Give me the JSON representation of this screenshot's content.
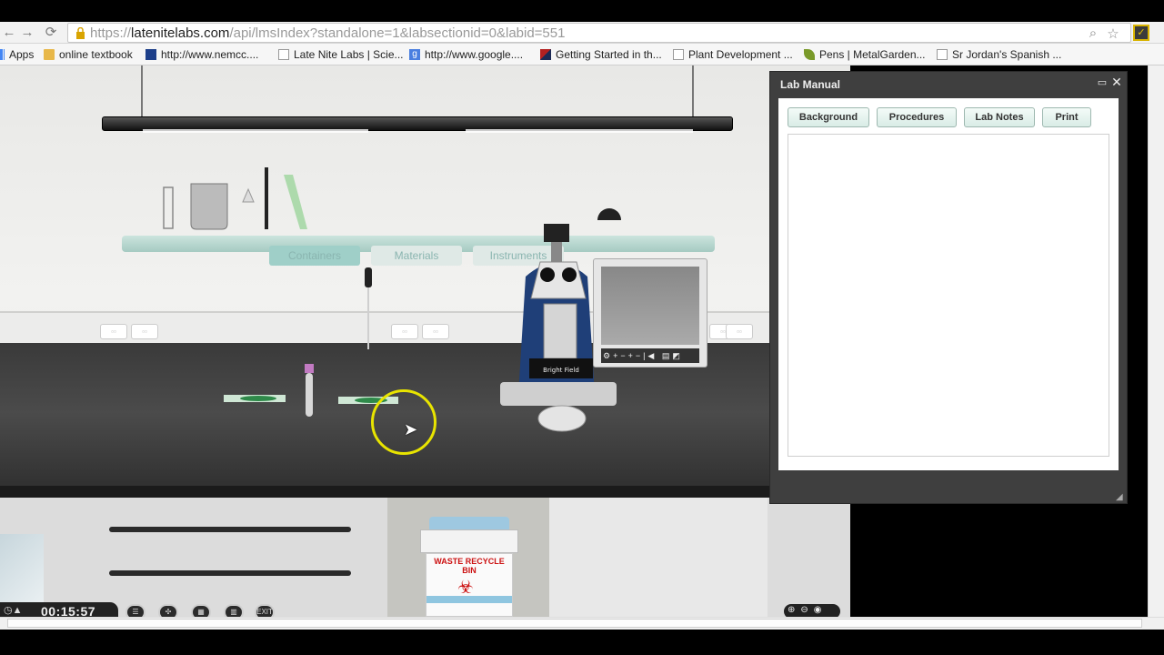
{
  "browser": {
    "url_scheme": "https://",
    "url_host": "latenitelabs.com",
    "url_path": "/api/lmsIndex?standalone=1&labsectionid=0&labid=551",
    "bookmarks": [
      {
        "label": "Apps",
        "icon": "apps-grid-icon"
      },
      {
        "label": "online textbook",
        "icon": "folder-icon"
      },
      {
        "label": "http://www.nemcc....",
        "icon": "site-favicon-icon"
      },
      {
        "label": "Late Nite Labs | Scie...",
        "icon": "page-icon"
      },
      {
        "label": "http://www.google....",
        "icon": "google-icon"
      },
      {
        "label": "Getting Started in th...",
        "icon": "site-favicon-icon"
      },
      {
        "label": "Plant Development ...",
        "icon": "page-icon"
      },
      {
        "label": "Pens | MetalGarden...",
        "icon": "leaf-icon"
      },
      {
        "label": "Sr Jordan's Spanish ...",
        "icon": "page-icon"
      }
    ]
  },
  "scene": {
    "shelf_tabs": [
      "Containers",
      "Materials",
      "Instruments"
    ],
    "microscope_label": "Bright Field",
    "bin_label": "WASTE RECYCLE BIN"
  },
  "lab_manual": {
    "title": "Lab Manual",
    "tabs": [
      "Background",
      "Procedures",
      "Lab Notes",
      "Print"
    ]
  },
  "footer": {
    "timer": "00:15:57"
  },
  "colors": {
    "cursor_ring": "#e8e400",
    "panel_bg": "#3f3f3f",
    "counter": "#3a3a3a"
  }
}
